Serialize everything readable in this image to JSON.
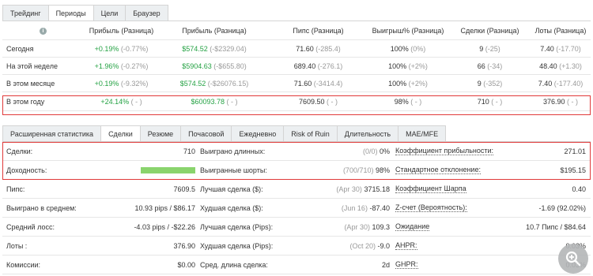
{
  "tabs1": [
    "Трейдинг",
    "Периоды",
    "Цели",
    "Браузер"
  ],
  "periods": {
    "info_icon": "i",
    "headers": [
      "Прибыль (Разница)",
      "Прибыль (Разница)",
      "Пипс (Разница)",
      "Выигрыш% (Разница)",
      "Сделки (Разница)",
      "Лоты (Разница)"
    ],
    "rows": [
      {
        "label": "Сегодня",
        "c1": "+0.19%",
        "c1d": "(-0.77%)",
        "c2": "$574.52",
        "c2d": "(-$2329.04)",
        "c3": "71.60",
        "c3d": "(-285.4)",
        "c4": "100%",
        "c4d": "(0%)",
        "c5": "9",
        "c5d": "(-25)",
        "c6": "7.40",
        "c6d": "(-17.70)"
      },
      {
        "label": "На этой неделе",
        "c1": "+1.96%",
        "c1d": "(-0.27%)",
        "c2": "$5904.63",
        "c2d": "(-$655.80)",
        "c3": "689.40",
        "c3d": "(-276.1)",
        "c4": "100%",
        "c4d": "(+2%)",
        "c5": "66",
        "c5d": "(-34)",
        "c6": "48.40",
        "c6d": "(+1.30)"
      },
      {
        "label": "В этом месяце",
        "c1": "+0.19%",
        "c1d": "(-9.32%)",
        "c2": "$574.52",
        "c2d": "(-$26076.15)",
        "c3": "71.60",
        "c3d": "(-3414.4)",
        "c4": "100%",
        "c4d": "(+2%)",
        "c5": "9",
        "c5d": "(-352)",
        "c6": "7.40",
        "c6d": "(-177.40)"
      },
      {
        "label": "В этом году",
        "c1": "+24.14%",
        "c1d": "( - )",
        "c2": "$60093.78",
        "c2d": "( - )",
        "c3": "7609.50",
        "c3d": "( - )",
        "c4": "98%",
        "c4d": "( - )",
        "c5": "710",
        "c5d": "( - )",
        "c6": "376.90",
        "c6d": "( - )"
      }
    ]
  },
  "tabs2": [
    "Расширенная статистика",
    "Сделки",
    "Резюме",
    "Почасовой",
    "Ежедневно",
    "Risk of Ruin",
    "Длительность",
    "MAE/MFE"
  ],
  "stats": {
    "rows": [
      {
        "l1": "Сделки:",
        "v1": "710",
        "l2": "Выиграно длинных:",
        "v2g": "(0/0)",
        "v2": "0%",
        "l3": "Коэффициент прибыльности:",
        "v3": "271.01"
      },
      {
        "l1": "Доходность:",
        "v1": "",
        "l2": "Выигранные шорты:",
        "v2g": "(700/710)",
        "v2": "98%",
        "l3": "Стандартное отклонение:",
        "v3": "$195.15"
      },
      {
        "l1": "Пипс:",
        "v1": "7609.5",
        "l2": "Лучшая сделка ($):",
        "v2g": "(Apr 30)",
        "v2": "3715.18",
        "l3": "Коэффициент Шарпа",
        "v3": "0.40"
      },
      {
        "l1": "Выиграно в среднем:",
        "v1": "10.93 pips / $86.17",
        "l2": "Худшая сделка ($):",
        "v2g": "(Jun 16)",
        "v2": "-87.40",
        "l3": "Z-счет (Вероятность):",
        "v3": "-1.69 (92.02%)"
      },
      {
        "l1": "Средний лосс:",
        "v1": "-4.03 pips / -$22.26",
        "l2": "Лучшая сделка (Pips):",
        "v2g": "(Apr 30)",
        "v2": "109.3",
        "l3": "Ожидание",
        "v3": "10.7 Пипс / $84.64"
      },
      {
        "l1": "Лоты :",
        "v1": "376.90",
        "l2": "Худшая сделка (Pips):",
        "v2g": "(Oct 20)",
        "v2": "-9.0",
        "l3": "AHPR:",
        "v3": "0.03%"
      },
      {
        "l1": "Комиссии:",
        "v1": "$0.00",
        "l2": "Сред. длина сделка:",
        "v2g": "",
        "v2": "2d",
        "l3": "GHPR:",
        "v3": "0.03%"
      }
    ],
    "profitability_fill": 1.0
  },
  "zoom_icon": "zoom-in-icon"
}
